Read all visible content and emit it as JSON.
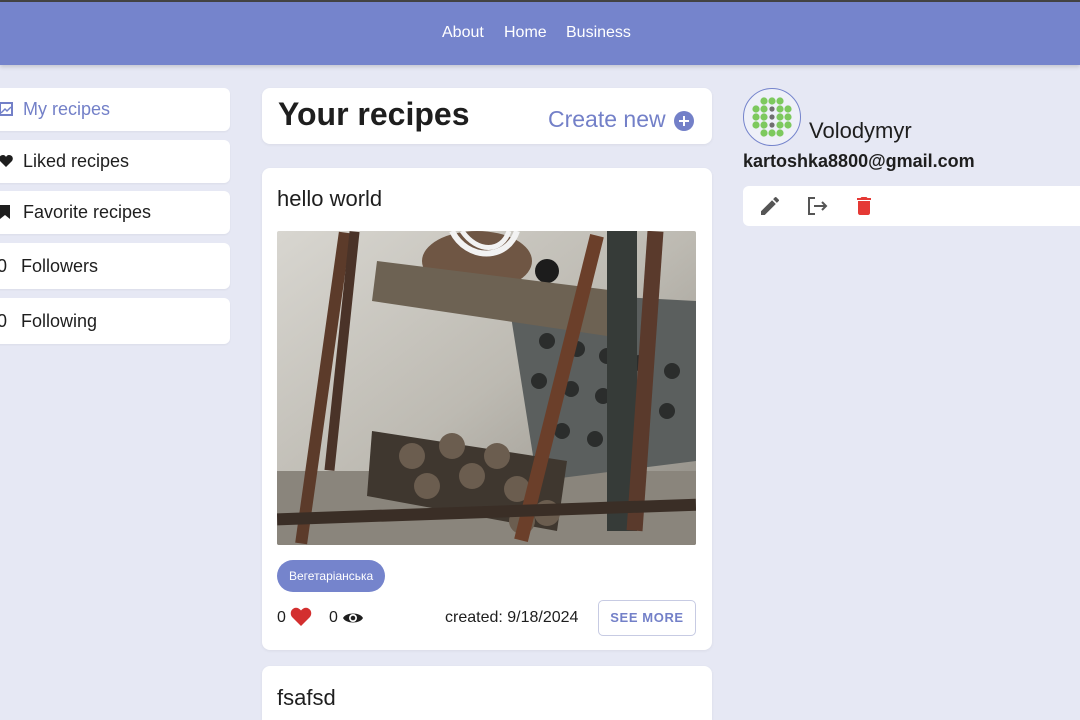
{
  "nav": {
    "links": [
      "About",
      "Home",
      "Business"
    ]
  },
  "sidebar": {
    "items": [
      {
        "label": "My recipes",
        "icon": "image-icon",
        "active": true
      },
      {
        "label": "Liked recipes",
        "icon": "heart-icon"
      },
      {
        "label": "Favorite recipes",
        "icon": "bookmark-icon"
      },
      {
        "label": "Followers",
        "count": "0"
      },
      {
        "label": "Following",
        "count": "0"
      }
    ]
  },
  "main": {
    "title": "Your recipes",
    "create_label": "Create new",
    "recipes": [
      {
        "title": "hello world",
        "tag": "Вегетаріанська",
        "likes": "0",
        "views": "0",
        "created": "created: 9/18/2024",
        "see_more": "SEE MORE"
      },
      {
        "title": "fsafsd"
      }
    ]
  },
  "profile": {
    "name": "Volodymyr",
    "email": "kartoshka8800@gmail.com",
    "actions": [
      "edit-icon",
      "logout-icon",
      "delete-icon"
    ]
  },
  "colors": {
    "accent": "#7584cc",
    "background": "#e6e8f4",
    "heart": "#d32f2f",
    "delete": "#e53935",
    "avatar_dots": "#7dc95e"
  }
}
